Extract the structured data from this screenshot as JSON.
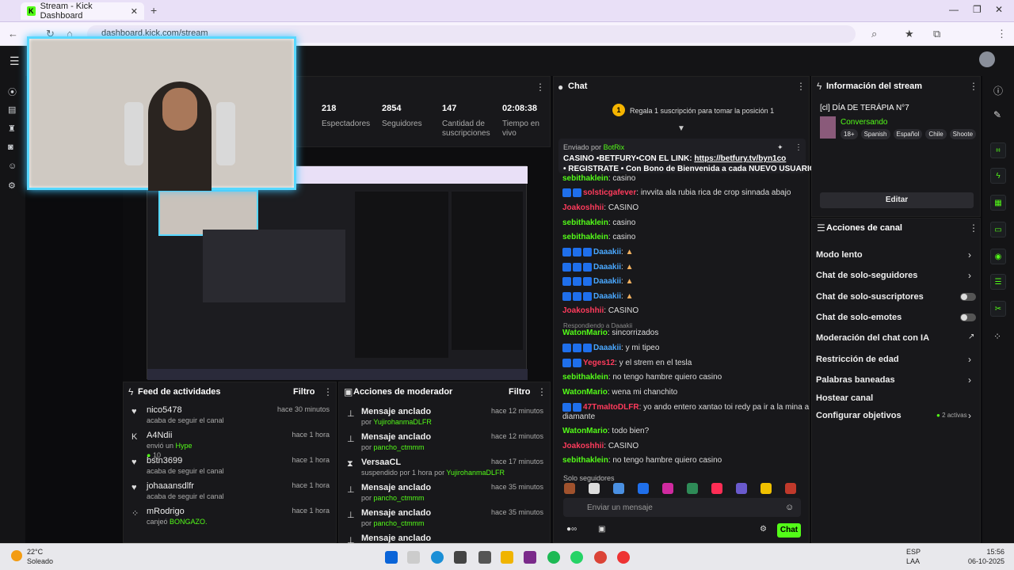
{
  "browser": {
    "tab_title": "Stream - Kick Dashboard",
    "url": "dashboard.kick.com/stream"
  },
  "stats": [
    {
      "value": "218",
      "label": "Espectadores"
    },
    {
      "value": "2854",
      "label": "Seguidores"
    },
    {
      "value": "147",
      "label": "Cantidad de suscripciones"
    },
    {
      "value": "02:08:38",
      "label": "Tiempo en vivo"
    }
  ],
  "feed": {
    "title": "Feed de actividades",
    "filter": "Filtro",
    "items": [
      {
        "name": "nico5478",
        "sub": "acaba de seguir el canal",
        "time": "hace 30 minutos",
        "icon": "heart-icon"
      },
      {
        "name": "A4Ndii",
        "sub": "envió un",
        "extra": "Hype",
        "count": "10",
        "time": "hace 1 hora",
        "icon": "kick-icon"
      },
      {
        "name": "bstn3699",
        "sub": "acaba de seguir el canal",
        "time": "hace 1 hora",
        "icon": "heart-icon"
      },
      {
        "name": "johaaansdlfr",
        "sub": "acaba de seguir el canal",
        "time": "hace 1 hora",
        "icon": "heart-icon"
      },
      {
        "name": "mRodrigo",
        "sub": "canjeó",
        "extra": "BONGAZO.",
        "time": "hace 1 hora",
        "icon": "dots-icon"
      }
    ]
  },
  "mod": {
    "title": "Acciones de moderador",
    "filter": "Filtro",
    "items": [
      {
        "title": "Mensaje anclado",
        "by": "por",
        "user": "YujirohanmaDLFR",
        "time": "hace 12 minutos",
        "icon": "pin-icon"
      },
      {
        "title": "Mensaje anclado",
        "by": "por",
        "user": "pancho_ctmmm",
        "time": "hace 12 minutos",
        "icon": "pin-icon"
      },
      {
        "title": "VersaaCL",
        "by": "suspendido por 1 hora por",
        "user": "YujirohanmaDLFR",
        "time": "hace 17 minutos",
        "icon": "hourglass-icon"
      },
      {
        "title": "Mensaje anclado",
        "by": "por",
        "user": "pancho_ctmmm",
        "time": "hace 35 minutos",
        "icon": "pin-icon"
      },
      {
        "title": "Mensaje anclado",
        "by": "por",
        "user": "pancho_ctmmm",
        "time": "hace 35 minutos",
        "icon": "pin-icon"
      },
      {
        "title": "Mensaje anclado",
        "by": "",
        "user": "",
        "time": "",
        "icon": "pin-icon"
      }
    ]
  },
  "chat": {
    "title": "Chat",
    "gift_banner": "Regala 1 suscripción para tomar la posición 1",
    "gift_pos": "1",
    "pinned_by": "Enviado por",
    "pinned_user": "BotRix",
    "pinned_line1_a": "CASINO",
    "pinned_line1_b": "•BETFURY•CON EL LINK:",
    "pinned_link": "https://betfury.tv/byn1co",
    "pinned_line2": "• REGISTRATE • Con Bono de Bienvenida a cada NUEVO USUARIO...",
    "messages": [
      {
        "user": "sebithaklein",
        "text": "casino",
        "color": "green",
        "badges": 0
      },
      {
        "user": "solsticgafever",
        "text": "invvita ala rubia rica de crop sinnada abajo",
        "color": "red",
        "badges": 2
      },
      {
        "user": "Joakoshhii",
        "text": "CASINO",
        "color": "red",
        "badges": 0
      },
      {
        "user": "sebithaklein",
        "text": "casino",
        "color": "green",
        "badges": 0
      },
      {
        "user": "sebithaklein",
        "text": "casino",
        "color": "green",
        "badges": 0
      },
      {
        "user": "Daaakii",
        "text": "",
        "color": "blue",
        "badges": 3
      },
      {
        "user": "Daaakii",
        "text": "",
        "color": "blue",
        "badges": 3
      },
      {
        "user": "Daaakii",
        "text": "",
        "color": "blue",
        "badges": 3
      },
      {
        "user": "Daaakii",
        "text": "",
        "color": "blue",
        "badges": 3
      },
      {
        "user": "Joakoshhii",
        "text": "CASINO",
        "color": "red",
        "badges": 0
      },
      {
        "user": "WatonMario",
        "text": "sincorrizados",
        "color": "green",
        "badges": 0
      },
      {
        "user": "Daaakii",
        "text": "y mi tipeo",
        "color": "blue",
        "badges": 3
      },
      {
        "user": "Yeges12",
        "text": "y el strem en el tesla",
        "color": "red",
        "badges": 2
      },
      {
        "user": "sebithaklein",
        "text": "no tengo hambre quiero casino",
        "color": "green",
        "badges": 0
      },
      {
        "user": "WatonMario",
        "text": "wena mi chanchito",
        "color": "green",
        "badges": 0
      },
      {
        "user": "47TmaltoDLFR",
        "text": "yo ando entero xantao toi redy pa ir a la mina a sacar",
        "color": "red",
        "badges": 2
      },
      {
        "user": "",
        "text": "diamante",
        "color": "green",
        "badges": 0
      },
      {
        "user": "WatonMario",
        "text": "todo bien?",
        "color": "green",
        "badges": 0
      },
      {
        "user": "Joakoshhii",
        "text": "CASINO",
        "color": "red",
        "badges": 0
      },
      {
        "user": "sebithaklein",
        "text": "no tengo hambre quiero casino",
        "color": "green",
        "badges": 0
      }
    ],
    "reply_label": "Respondiendo a Daaakii",
    "followers_only": "Solo seguidores",
    "input_placeholder": "Enviar un mensaje",
    "send": "Chat"
  },
  "info": {
    "title": "Información del stream",
    "stream_title": "[cl] DÍA DE TERÁPIA N°7",
    "category": "Conversando",
    "tags": [
      "18+",
      "Spanish",
      "Español",
      "Chile",
      "Shoote"
    ],
    "edit": "Editar"
  },
  "actions": {
    "title": "Acciones de canal",
    "items": [
      {
        "label": "Modo lento",
        "ctrl": "chevron"
      },
      {
        "label": "Chat de solo-seguidores",
        "ctrl": "chevron"
      },
      {
        "label": "Chat de solo-suscriptores",
        "ctrl": "toggle"
      },
      {
        "label": "Chat de solo-emotes",
        "ctrl": "toggle"
      },
      {
        "label": "Moderación del chat con IA",
        "ctrl": "external"
      },
      {
        "label": "Restricción de edad",
        "ctrl": "chevron"
      },
      {
        "label": "Palabras baneadas",
        "ctrl": "chevron"
      },
      {
        "label": "Hostear canal",
        "ctrl": "none"
      },
      {
        "label": "Configurar objetivos",
        "ctrl": "chevron",
        "badge": "2 activas"
      }
    ]
  },
  "taskbar": {
    "temp": "22°C",
    "weather": "Soleado",
    "lang": "ESP",
    "region": "LAA",
    "time": "15:56",
    "date": "06-10-2025"
  }
}
